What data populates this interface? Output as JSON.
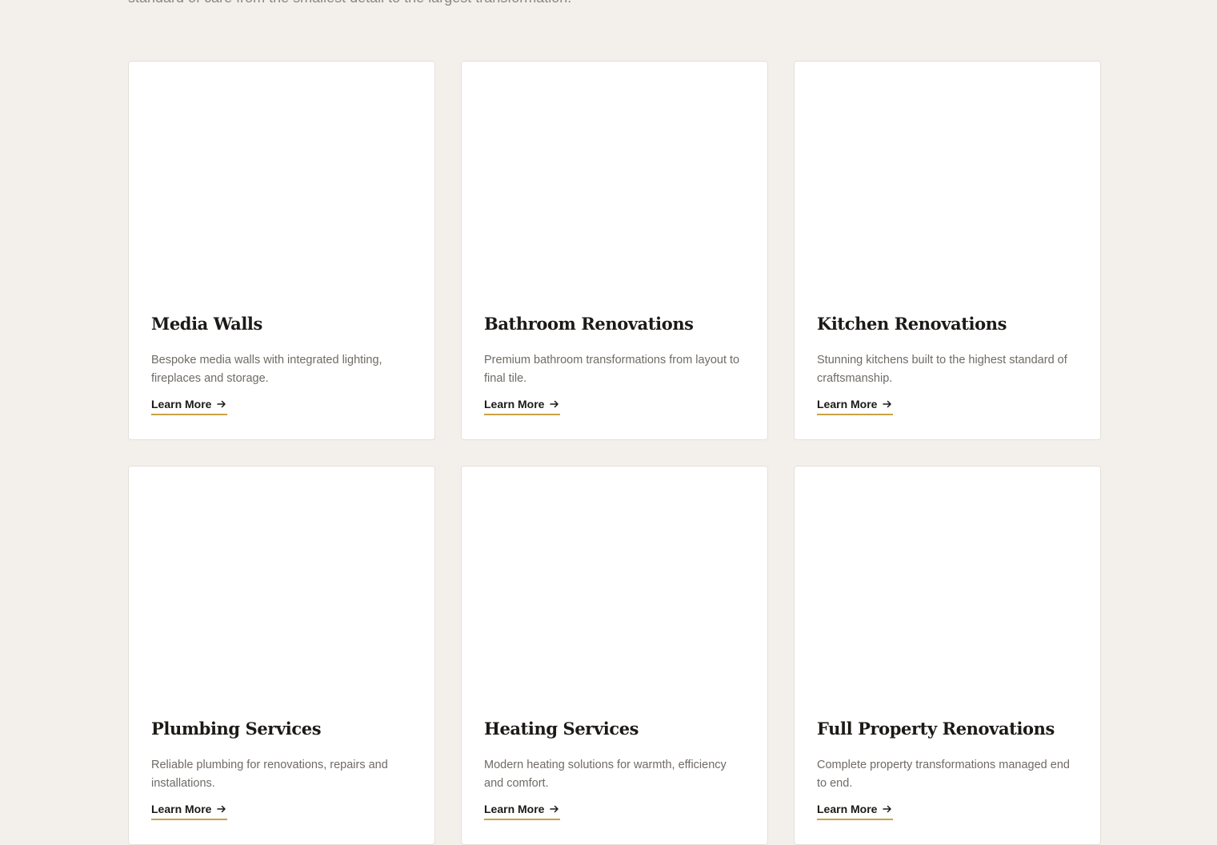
{
  "intro": {
    "text": "standard of care from the smallest detail to the largest transformation."
  },
  "services": [
    {
      "title": "Media Walls",
      "description": "Bespoke media walls with integrated lighting, fireplaces and storage.",
      "cta": "Learn More"
    },
    {
      "title": "Bathroom Renovations",
      "description": "Premium bathroom transformations from layout to final tile.",
      "cta": "Learn More"
    },
    {
      "title": "Kitchen Renovations",
      "description": "Stunning kitchens built to the highest standard of craftsmanship.",
      "cta": "Learn More"
    },
    {
      "title": "Plumbing Services",
      "description": "Reliable plumbing for renovations, repairs and installations.",
      "cta": "Learn More"
    },
    {
      "title": "Heating Services",
      "description": "Modern heating solutions for warmth, efficiency and comfort.",
      "cta": "Learn More"
    },
    {
      "title": "Full Property Renovations",
      "description": "Complete property transformations managed end to end.",
      "cta": "Learn More"
    }
  ],
  "colors": {
    "page_background": "#f3f0ec",
    "card_background": "#ffffff",
    "accent": "#c9a245",
    "heading": "#1c1a17",
    "body_text": "#6f6b66"
  },
  "icons": {
    "cta_icon": "arrow-right-icon"
  }
}
